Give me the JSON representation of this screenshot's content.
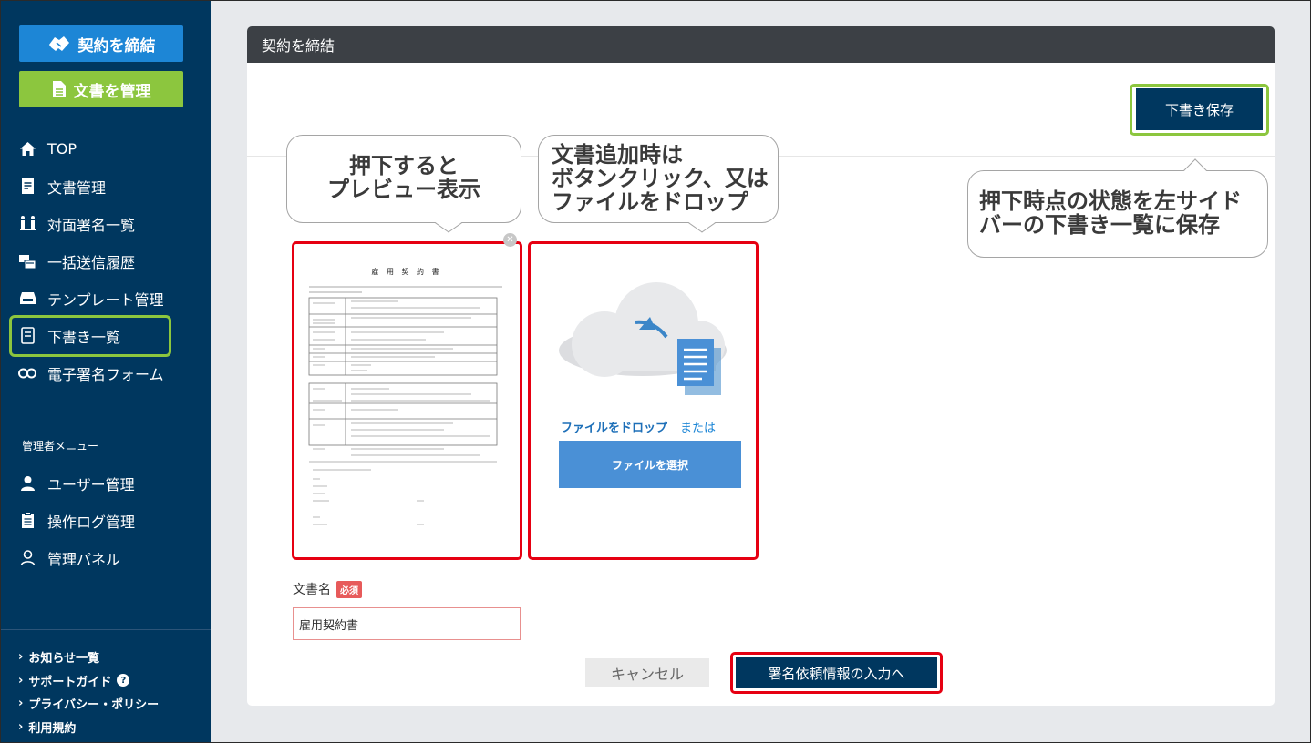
{
  "sidebar": {
    "contract_button": "契約を締結",
    "docs_button": "文書を管理",
    "nav": [
      {
        "label": "TOP",
        "icon": "home-icon"
      },
      {
        "label": "文書管理",
        "icon": "document-icon"
      },
      {
        "label": "対面署名一覧",
        "icon": "face-sign-icon"
      },
      {
        "label": "一括送信履歴",
        "icon": "bulk-send-icon"
      },
      {
        "label": "テンプレート管理",
        "icon": "template-icon"
      },
      {
        "label": "下書き一覧",
        "icon": "draft-icon"
      },
      {
        "label": "電子署名フォーム",
        "icon": "link-icon"
      }
    ],
    "admin_title": "管理者メニュー",
    "admin_nav": [
      {
        "label": "ユーザー管理",
        "icon": "user-icon"
      },
      {
        "label": "操作ログ管理",
        "icon": "clipboard-icon"
      },
      {
        "label": "管理パネル",
        "icon": "admin-user-icon"
      }
    ],
    "footer_links": [
      "お知らせ一覧",
      "サポートガイド",
      "プライバシー・ポリシー",
      "利用規約"
    ]
  },
  "panel": {
    "title": "契約を締結",
    "draft_save": "下書き保存"
  },
  "callouts": {
    "preview": [
      "押下すると",
      "プレビュー表示"
    ],
    "add_doc": [
      "文書追加時は",
      "ボタンクリック、又は",
      "ファイルをドロップ"
    ],
    "draft": [
      "押下時点の状態を左サイド",
      "バーの下書き一覧に保存"
    ]
  },
  "preview": {
    "doc_title": "雇 用 契 約 書"
  },
  "dropzone": {
    "drop_label": "ファイルをドロップ",
    "or_label": "または",
    "select_button": "ファイルを選択"
  },
  "docname": {
    "label": "文書名",
    "required": "必須",
    "value": "雇用契約書"
  },
  "actions": {
    "cancel": "キャンセル",
    "next": "署名依頼情報の入力へ"
  },
  "colors": {
    "sidebar_bg": "#00375f",
    "contract_btn": "#1d86d6",
    "docs_btn": "#8cc63e",
    "highlight_red": "#e60012",
    "highlight_green": "#8cc63e",
    "header_bg": "#3c4045"
  }
}
